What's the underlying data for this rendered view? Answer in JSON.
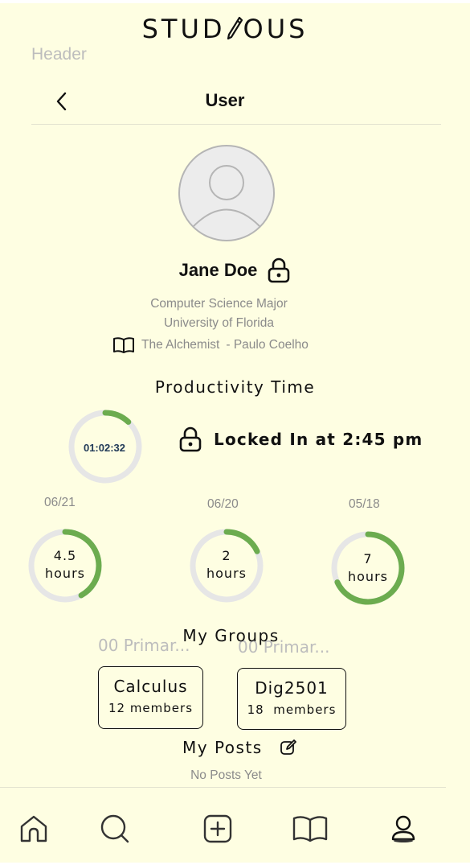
{
  "app": {
    "brand_left": "STUD",
    "brand_right": "OUS",
    "header_ghost": "Header"
  },
  "topbar": {
    "title": "User"
  },
  "profile": {
    "name": "Jane Doe",
    "major": "Computer Science Major",
    "university": "University of Florida",
    "book_title": "The Alchemist",
    "book_author": "- Paulo Coelho"
  },
  "productivity": {
    "heading": "Productivity Time",
    "timer": "01:02:32",
    "timer_progress": 0.12,
    "status": "Locked In at 2:45 pm",
    "history": [
      {
        "date": "06/21",
        "value": "4.5",
        "unit": "hours",
        "progress": 0.42
      },
      {
        "date": "06/20",
        "value": "2",
        "unit": "hours",
        "progress": 0.18
      },
      {
        "date": "05/18",
        "value": "7",
        "unit": "hours",
        "progress": 0.68
      }
    ]
  },
  "groups": {
    "heading": "My Groups",
    "ghosts": [
      "00 Primar...",
      "00 Primar..."
    ],
    "items": [
      {
        "name": "Calculus",
        "count": "12 members"
      },
      {
        "name": "Dig2501",
        "count": "18  members"
      }
    ]
  },
  "posts": {
    "heading": "My Posts",
    "empty": "No Posts Yet"
  },
  "nav": {
    "icons": [
      "home-icon",
      "search-icon",
      "add-icon",
      "book-icon",
      "profile-icon"
    ]
  },
  "colors": {
    "background": "#fefee2",
    "ring_track": "#e6e6e6",
    "ring_progress": "#6cac4f",
    "timer_text": "#213a58"
  }
}
